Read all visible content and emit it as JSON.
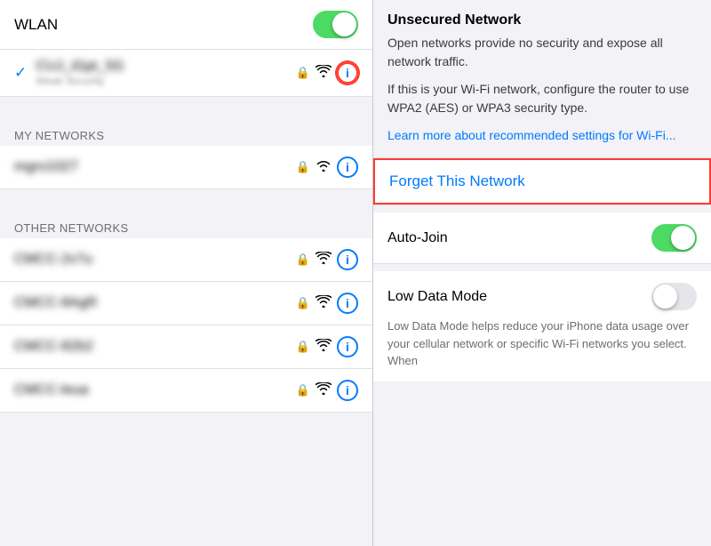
{
  "left": {
    "wlan_label": "WLAN",
    "connected_network_name": "CUJ_iGpt_5G",
    "connected_network_sub": "Weak Security",
    "my_networks_header": "MY NETWORKS",
    "my_network_1": "mgro1027",
    "other_networks_header": "OTHER NETWORKS",
    "other_networks": [
      "CMCC-2v7u",
      "CMCC-8AgR",
      "CMCC-82b2",
      "CMCC-leua"
    ]
  },
  "right": {
    "unsecured_title": "Unsecured Network",
    "unsecured_text_1": "Open networks provide no security and expose all network traffic.",
    "unsecured_text_2": "If this is your Wi-Fi network, configure the router to use WPA2 (AES) or WPA3 security type.",
    "learn_more": "Learn more about recommended settings for Wi-Fi...",
    "forget_label": "Forget This Network",
    "auto_join_label": "Auto-Join",
    "low_data_label": "Low Data Mode",
    "low_data_desc": "Low Data Mode helps reduce your iPhone data usage over your cellular network or specific Wi-Fi networks you select. When"
  },
  "icons": {
    "info": "i",
    "lock": "🔒",
    "wifi": "📶"
  }
}
